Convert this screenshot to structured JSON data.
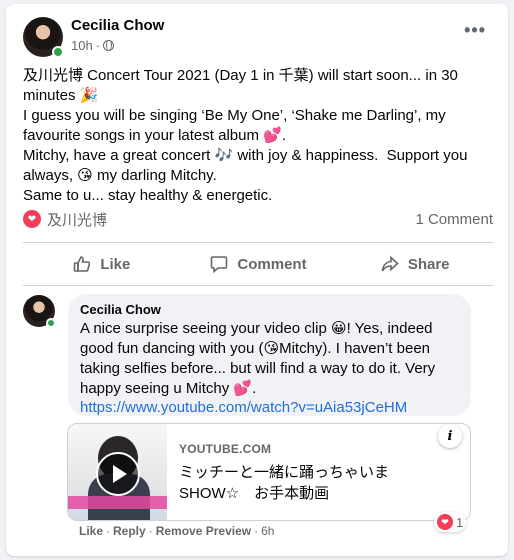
{
  "post": {
    "author": "Cecilia Chow",
    "time": "10h",
    "dot": "·",
    "text_lines": [
      "及川光博 Concert Tour 2021 (Day 1 in 千葉) will start soon... in 30 minutes 🎉",
      "I guess you will be singing ‘Be My One’, ‘Shake me Darling’, my favourite songs in your latest album 💕.",
      "Mitchy, have a great concert 🎶 with joy & happiness.  Support you always, 😘 my darling Mitchy.",
      "Same to u... stay healthy & energetic."
    ],
    "reactions_name": "及川光博",
    "comment_count": "1 Comment"
  },
  "actions": {
    "like": "Like",
    "comment": "Comment",
    "share": "Share"
  },
  "comment": {
    "author": "Cecilia Chow",
    "text": "A nice surprise seeing your video clip 😀! Yes, indeed good fun dancing with you (😘Mitchy). I haven’t been taking selfies before... but will find a way to do it. Very happy seeing u Mitchy 💕.",
    "link": "https://www.youtube.com/watch?v=uAia53jCeHM",
    "preview": {
      "domain": "YOUTUBE.COM",
      "title": "ミッチーと一緒に踊っちゃいま SHOW☆　お手本動画",
      "info": "i"
    },
    "like_label": "Like",
    "reply_label": "Reply",
    "remove_label": "Remove Preview",
    "time": "6h",
    "sep": "·",
    "reaction_count": "1"
  },
  "colors": {
    "accent_link": "#216fdb",
    "heart": "#f33e58",
    "online": "#31a24c"
  },
  "icons": [
    "more-options-icon",
    "globe-icon",
    "heart-reaction-icon",
    "like-thumb-icon",
    "comment-bubble-icon",
    "share-arrow-icon",
    "play-icon",
    "info-icon"
  ]
}
